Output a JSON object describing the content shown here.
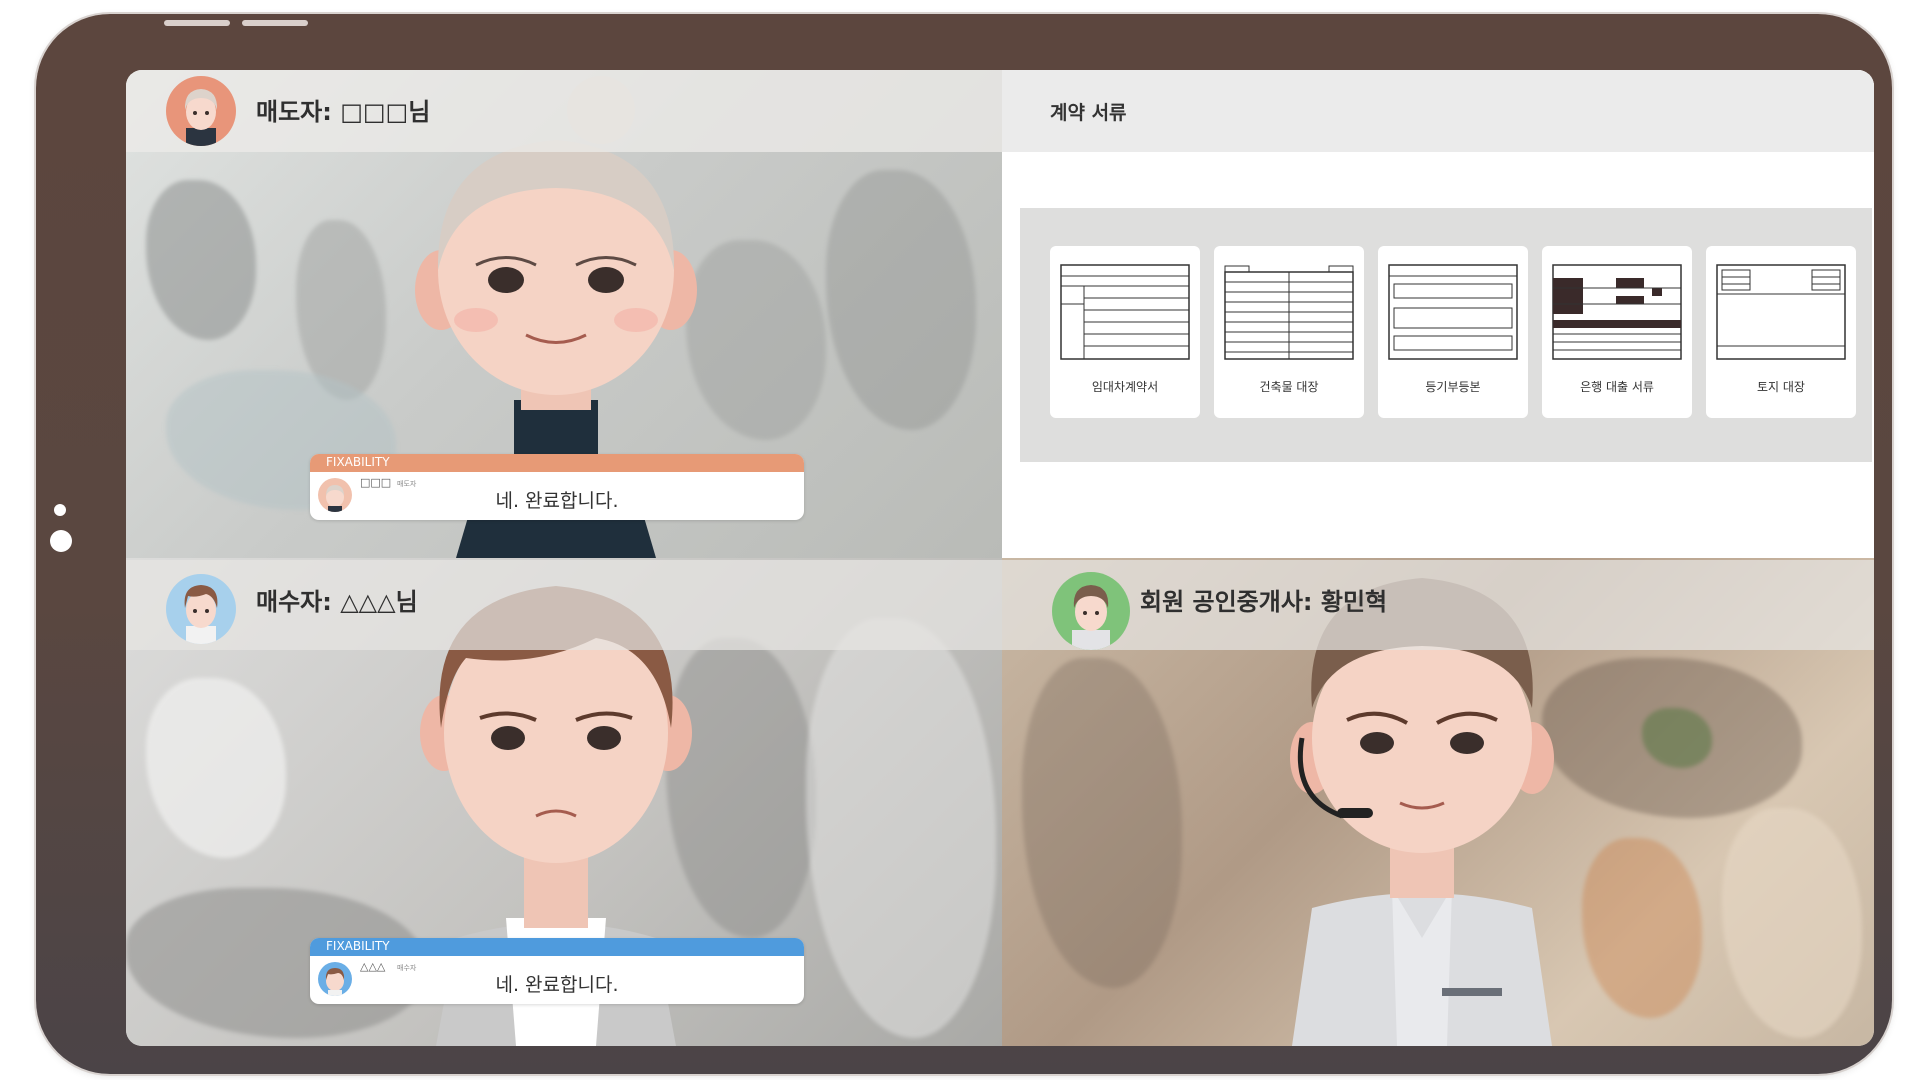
{
  "colors": {
    "frame": "#5a463f",
    "seller_accent": "#e79a76",
    "buyer_accent": "#4f9bdd"
  },
  "participants": {
    "seller": {
      "label": "매도자: □□□님",
      "avatar": "elderly-woman-avatar"
    },
    "buyer": {
      "label": "매수자: △△△님",
      "avatar": "young-man-avatar"
    },
    "broker": {
      "label": "회원 공인중개사: 황민혁",
      "avatar": "broker-headset-avatar"
    }
  },
  "documents": {
    "title": "계약 서류",
    "items": [
      {
        "label": "임대차계약서",
        "icon": "lease-contract-document-icon"
      },
      {
        "label": "건축물 대장",
        "icon": "building-register-document-icon"
      },
      {
        "label": "등기부등본",
        "icon": "property-registry-document-icon"
      },
      {
        "label": "은행 대출 서류",
        "icon": "bank-loan-document-icon"
      },
      {
        "label": "토지 대장",
        "icon": "land-register-document-icon"
      }
    ]
  },
  "captions": {
    "seller": {
      "brand": "FIXABILITY",
      "name": "□□□",
      "role": "매도자",
      "text": "네. 완료합니다."
    },
    "buyer": {
      "brand": "FIXABILITY",
      "name": "△△△",
      "role": "매수자",
      "text": "네. 완료합니다."
    }
  }
}
